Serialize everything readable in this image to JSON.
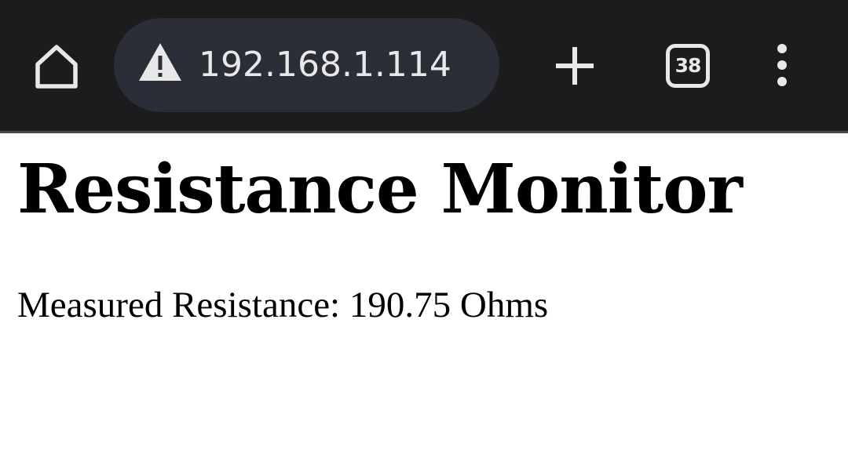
{
  "browser": {
    "url": "192.168.1.114",
    "tab_count": "38",
    "icons": {
      "home": "home-icon",
      "security": "warning-icon",
      "new_tab": "plus-icon",
      "tabs": "tab-switcher-icon",
      "menu": "more-vert-icon"
    },
    "colors": {
      "toolbar": "#1c1c1e",
      "omnibox": "#2b2e36",
      "icon": "#e8e8ea"
    }
  },
  "page": {
    "title": "Resistance Monitor",
    "measurement_label": "Measured Resistance:",
    "measurement_value": "190.75",
    "measurement_unit": "Ohms"
  }
}
